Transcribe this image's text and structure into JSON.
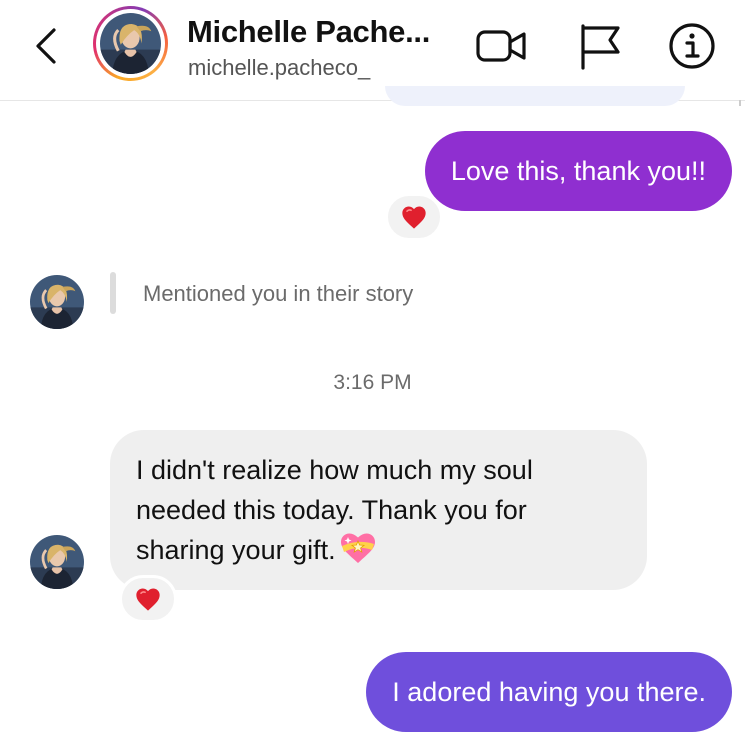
{
  "header": {
    "contact_name": "Michelle Pache...",
    "contact_handle": "michelle.pacheco_",
    "icons": [
      "back-chevron-icon",
      "video-call-icon",
      "flag-icon",
      "info-icon"
    ]
  },
  "messages": {
    "out_1": {
      "text": "Love this, thank you!!",
      "reaction": "heart-reaction-icon"
    },
    "story_mention": {
      "text": "Mentioned you in their story"
    },
    "timestamp": "3:16 PM",
    "in_1": {
      "text": "I didn't realize how much my soul needed this today. Thank you for sharing your gift.",
      "emoji": "sparkling-heart-icon",
      "reaction": "heart-reaction-icon"
    },
    "out_2": {
      "text": "I adored having you there."
    }
  },
  "colors": {
    "outgoing_bubble_1": "#8f2fd0",
    "outgoing_bubble_2": "#6f4fdc",
    "incoming_bubble": "#efefef",
    "reaction_heart": "#e0202e"
  }
}
